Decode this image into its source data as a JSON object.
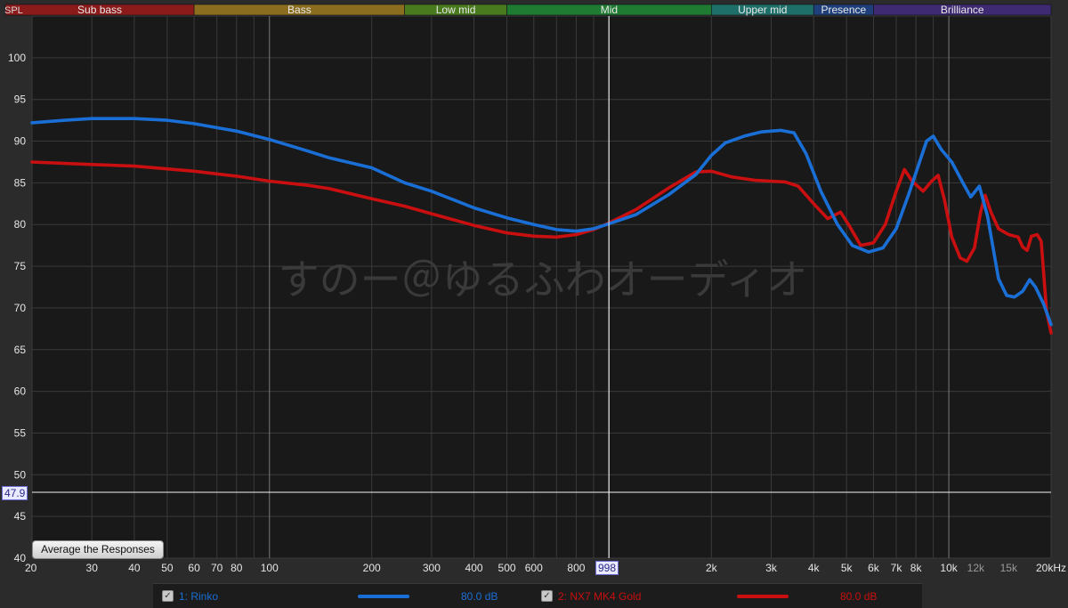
{
  "axis_title": "SPL",
  "watermark": "すのー＠ゆるふわオーディオ",
  "average_button_label": "Average the Responses",
  "cursor": {
    "x_label": "998",
    "y_label": "47.9",
    "x_value": 998,
    "y_value": 47.9
  },
  "bands": [
    {
      "label": "Sub bass",
      "from": 20,
      "to": 60,
      "color": "#8b1a1a"
    },
    {
      "label": "Bass",
      "from": 60,
      "to": 250,
      "color": "#8a6d1f"
    },
    {
      "label": "Low mid",
      "from": 250,
      "to": 500,
      "color": "#4a7a1e"
    },
    {
      "label": "Mid",
      "from": 500,
      "to": 2000,
      "color": "#1f7a32"
    },
    {
      "label": "Upper mid",
      "from": 2000,
      "to": 4000,
      "color": "#1e6f6a"
    },
    {
      "label": "Presence",
      "from": 4000,
      "to": 6000,
      "color": "#1e3f7a"
    },
    {
      "label": "Brilliance",
      "from": 6000,
      "to": 20000,
      "color": "#3e2a72"
    }
  ],
  "legend": [
    {
      "label": "1: Rinko",
      "level": "80.0 dB",
      "color": "#1a6fd6",
      "checked": "✓"
    },
    {
      "label": "2: NX7 MK4 Gold",
      "level": "80.0 dB",
      "color": "#c90f0f",
      "checked": "✓"
    }
  ],
  "chart_data": {
    "type": "line",
    "xscale": "log",
    "xlim": [
      20,
      20000
    ],
    "ylim": [
      40,
      105
    ],
    "grid": true,
    "yticks": [
      40,
      45,
      50,
      55,
      60,
      65,
      70,
      75,
      80,
      85,
      90,
      95,
      100
    ],
    "xticks": [
      {
        "v": 20,
        "t": "20"
      },
      {
        "v": 30,
        "t": "30"
      },
      {
        "v": 40,
        "t": "40"
      },
      {
        "v": 50,
        "t": "50"
      },
      {
        "v": 60,
        "t": "60"
      },
      {
        "v": 70,
        "t": "70"
      },
      {
        "v": 80,
        "t": "80"
      },
      {
        "v": 100,
        "t": "100"
      },
      {
        "v": 200,
        "t": "200"
      },
      {
        "v": 300,
        "t": "300"
      },
      {
        "v": 400,
        "t": "400"
      },
      {
        "v": 500,
        "t": "500"
      },
      {
        "v": 600,
        "t": "600"
      },
      {
        "v": 800,
        "t": "800"
      },
      {
        "v": 2000,
        "t": "2k"
      },
      {
        "v": 3000,
        "t": "3k"
      },
      {
        "v": 4000,
        "t": "4k"
      },
      {
        "v": 5000,
        "t": "5k"
      },
      {
        "v": 6000,
        "t": "6k"
      },
      {
        "v": 7000,
        "t": "7k"
      },
      {
        "v": 8000,
        "t": "8k"
      },
      {
        "v": 10000,
        "t": "10k"
      },
      {
        "v": 12000,
        "t": "12k"
      },
      {
        "v": 15000,
        "t": "15k"
      },
      {
        "v": 20000,
        "t": "20kHz"
      }
    ],
    "series": [
      {
        "name": "1: Rinko",
        "color": "#1a6fd6",
        "points": [
          [
            20,
            92.2
          ],
          [
            25,
            92.5
          ],
          [
            30,
            92.7
          ],
          [
            40,
            92.7
          ],
          [
            50,
            92.5
          ],
          [
            60,
            92.1
          ],
          [
            80,
            91.2
          ],
          [
            100,
            90.2
          ],
          [
            130,
            88.8
          ],
          [
            150,
            88.0
          ],
          [
            200,
            86.8
          ],
          [
            250,
            85.0
          ],
          [
            300,
            84.0
          ],
          [
            400,
            82.0
          ],
          [
            500,
            80.8
          ],
          [
            600,
            80.0
          ],
          [
            700,
            79.4
          ],
          [
            800,
            79.2
          ],
          [
            900,
            79.5
          ],
          [
            1000,
            80.1
          ],
          [
            1200,
            81.2
          ],
          [
            1500,
            83.6
          ],
          [
            1800,
            86.0
          ],
          [
            2000,
            88.3
          ],
          [
            2200,
            89.8
          ],
          [
            2500,
            90.6
          ],
          [
            2800,
            91.1
          ],
          [
            3200,
            91.3
          ],
          [
            3500,
            91.0
          ],
          [
            3800,
            88.5
          ],
          [
            4200,
            84.0
          ],
          [
            4700,
            80.0
          ],
          [
            5200,
            77.5
          ],
          [
            5800,
            76.7
          ],
          [
            6400,
            77.2
          ],
          [
            7000,
            79.5
          ],
          [
            7600,
            83.5
          ],
          [
            8200,
            87.5
          ],
          [
            8600,
            90.0
          ],
          [
            9000,
            90.6
          ],
          [
            9500,
            89.0
          ],
          [
            10200,
            87.5
          ],
          [
            11000,
            85.0
          ],
          [
            11600,
            83.3
          ],
          [
            12300,
            84.6
          ],
          [
            13000,
            81.0
          ],
          [
            14000,
            73.5
          ],
          [
            14800,
            71.5
          ],
          [
            15600,
            71.3
          ],
          [
            16500,
            72.0
          ],
          [
            17300,
            73.4
          ],
          [
            18000,
            72.5
          ],
          [
            19000,
            70.5
          ],
          [
            20000,
            68.0
          ]
        ]
      },
      {
        "name": "2: NX7 MK4 Gold",
        "color": "#c90f0f",
        "points": [
          [
            20,
            87.5
          ],
          [
            30,
            87.2
          ],
          [
            40,
            87.0
          ],
          [
            60,
            86.4
          ],
          [
            80,
            85.8
          ],
          [
            100,
            85.2
          ],
          [
            130,
            84.7
          ],
          [
            150,
            84.3
          ],
          [
            200,
            83.1
          ],
          [
            250,
            82.2
          ],
          [
            300,
            81.3
          ],
          [
            400,
            79.9
          ],
          [
            500,
            79.0
          ],
          [
            600,
            78.6
          ],
          [
            700,
            78.5
          ],
          [
            800,
            78.8
          ],
          [
            900,
            79.4
          ],
          [
            1000,
            80.2
          ],
          [
            1200,
            81.8
          ],
          [
            1500,
            84.4
          ],
          [
            1800,
            86.3
          ],
          [
            2000,
            86.4
          ],
          [
            2300,
            85.7
          ],
          [
            2700,
            85.3
          ],
          [
            3000,
            85.2
          ],
          [
            3300,
            85.1
          ],
          [
            3600,
            84.6
          ],
          [
            4000,
            82.5
          ],
          [
            4400,
            80.7
          ],
          [
            4800,
            81.5
          ],
          [
            5100,
            79.8
          ],
          [
            5500,
            77.5
          ],
          [
            6000,
            77.8
          ],
          [
            6500,
            80.0
          ],
          [
            7000,
            84.0
          ],
          [
            7400,
            86.6
          ],
          [
            7800,
            85.2
          ],
          [
            8400,
            84.0
          ],
          [
            8900,
            85.2
          ],
          [
            9300,
            85.9
          ],
          [
            9700,
            83.0
          ],
          [
            10200,
            78.5
          ],
          [
            10800,
            76.0
          ],
          [
            11300,
            75.6
          ],
          [
            11900,
            77.2
          ],
          [
            12400,
            81.5
          ],
          [
            12800,
            83.5
          ],
          [
            13300,
            81.5
          ],
          [
            14000,
            79.5
          ],
          [
            15000,
            78.8
          ],
          [
            16000,
            78.5
          ],
          [
            16500,
            77.3
          ],
          [
            17000,
            76.9
          ],
          [
            17500,
            78.6
          ],
          [
            18200,
            78.8
          ],
          [
            18700,
            78.0
          ],
          [
            19400,
            69.5
          ],
          [
            20000,
            67.0
          ]
        ]
      }
    ]
  }
}
